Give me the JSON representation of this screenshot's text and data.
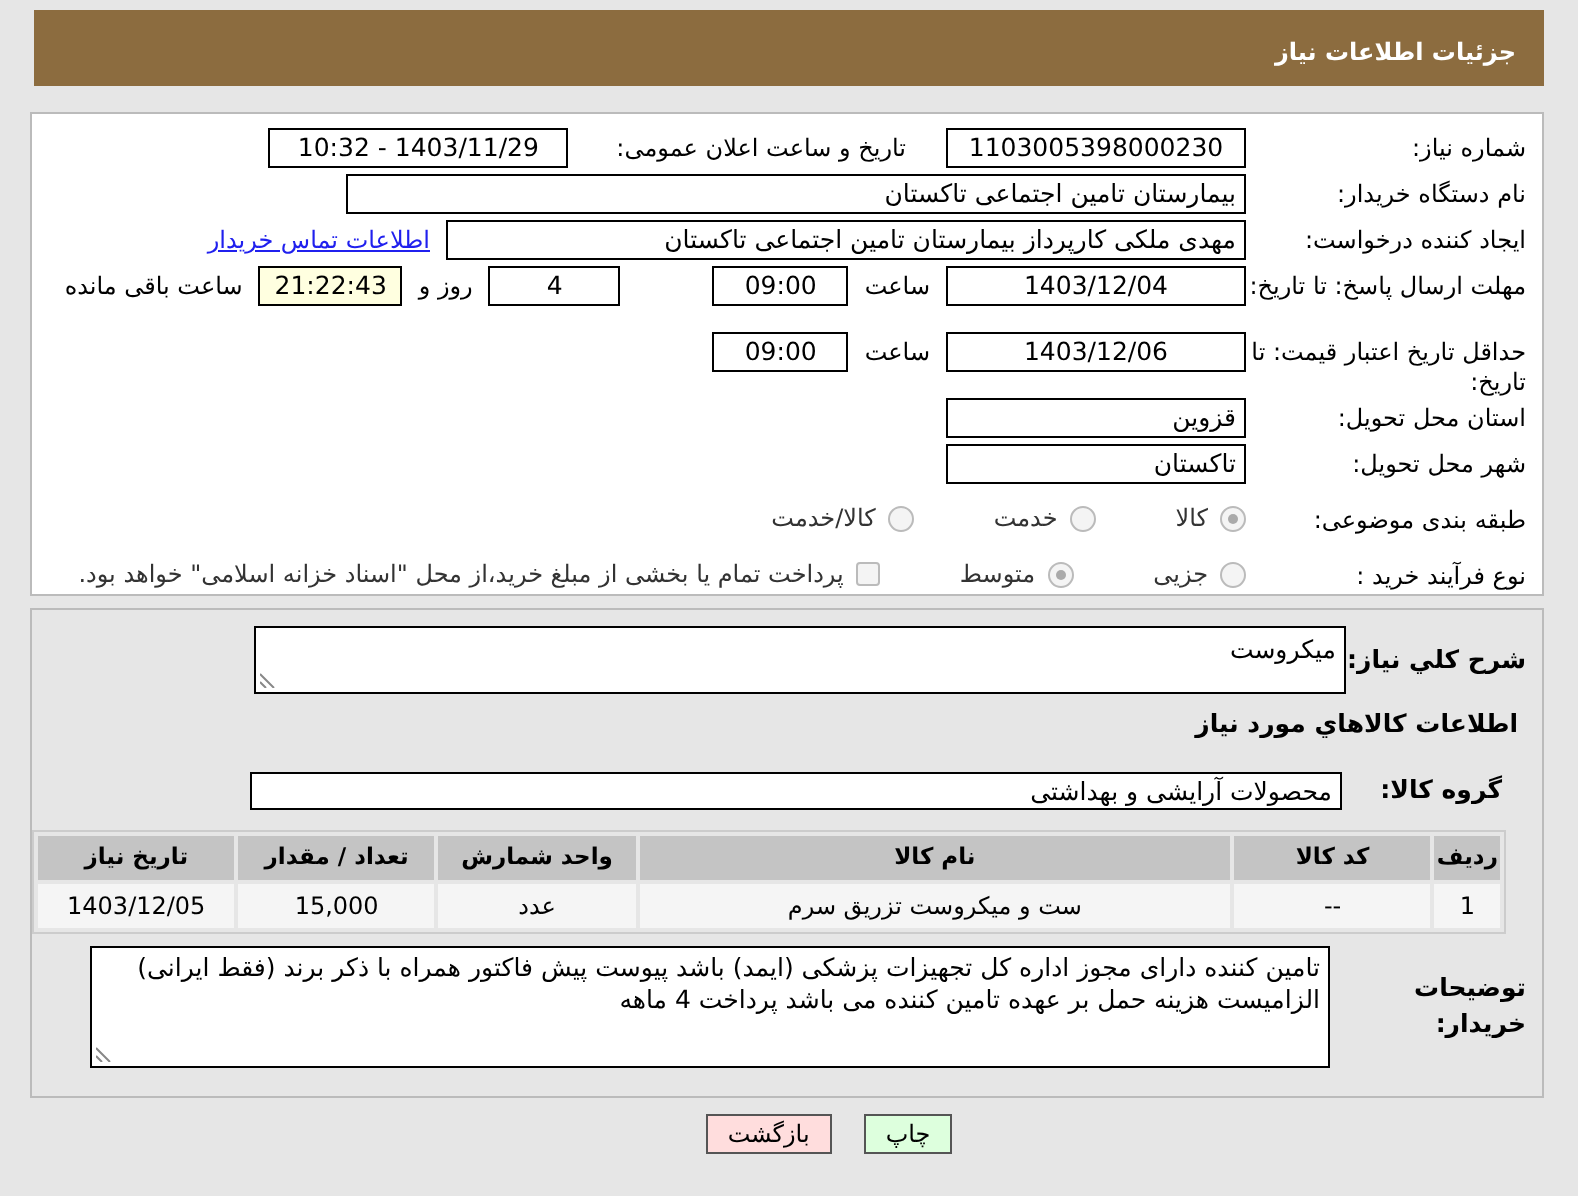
{
  "header": {
    "title": "جزئیات اطلاعات نیاز"
  },
  "form_rows": [
    {
      "label": "شماره نیاز:",
      "items": [
        {
          "kind": "field",
          "value": "1103005398000230"
        },
        {
          "kind": "text",
          "value": "تاریخ و ساعت اعلان عمومی:"
        },
        {
          "kind": "field",
          "value": "1403/11/29 - 10:32"
        }
      ]
    },
    {
      "label": "نام دستگاه خریدار:",
      "items": [
        {
          "kind": "field",
          "value": "بیمارستان تامین اجتماعی تاکستان"
        }
      ]
    },
    {
      "label": "ایجاد کننده درخواست:",
      "items": [
        {
          "kind": "field",
          "value": "مهدی ملکی کارپرداز بیمارستان تامین اجتماعی تاکستان"
        },
        {
          "kind": "link",
          "value": "اطلاعات تماس خریدار"
        }
      ]
    },
    {
      "label": "مهلت ارسال پاسخ: تا تاریخ:",
      "items": [
        {
          "kind": "field",
          "value": "1403/12/04"
        },
        {
          "kind": "text",
          "value": "ساعت"
        },
        {
          "kind": "field",
          "value": "09:00"
        },
        {
          "kind": "field",
          "value": "4"
        },
        {
          "kind": "text",
          "value": "روز و"
        },
        {
          "kind": "countdown",
          "value": "21:22:43"
        },
        {
          "kind": "text",
          "value": "ساعت باقی مانده"
        }
      ]
    },
    {
      "label": "حداقل تاریخ اعتبار قیمت: تا تاریخ:",
      "items": [
        {
          "kind": "field",
          "value": "1403/12/06"
        },
        {
          "kind": "text",
          "value": "ساعت"
        },
        {
          "kind": "field",
          "value": "09:00"
        }
      ]
    },
    {
      "label": "استان محل تحویل:",
      "items": [
        {
          "kind": "field",
          "value": "قزوین"
        }
      ]
    },
    {
      "label": "شهر محل تحویل:",
      "items": [
        {
          "kind": "field",
          "value": "تاکستان"
        }
      ]
    },
    {
      "label": "طبقه بندی موضوعی:",
      "items": [
        {
          "kind": "radio",
          "value": "کالا",
          "selected": true,
          "disabled": true
        },
        {
          "kind": "radio",
          "value": "خدمت",
          "selected": false,
          "disabled": true
        },
        {
          "kind": "radio",
          "value": "کالا/خدمت",
          "selected": false,
          "disabled": true
        }
      ]
    },
    {
      "label": "نوع فرآیند خرید :",
      "items": [
        {
          "kind": "radio",
          "value": "جزیی",
          "selected": false,
          "disabled": true
        },
        {
          "kind": "radio",
          "value": "متوسط",
          "selected": true,
          "disabled": true
        },
        {
          "kind": "checkbox",
          "value": "پرداخت تمام یا بخشی از مبلغ خرید،از محل \"اسناد خزانه اسلامی\" خواهد بود.",
          "checked": false,
          "disabled": true
        }
      ]
    }
  ],
  "description": {
    "label": "شرح کلي نياز:",
    "value": "میکروست"
  },
  "section_title": "اطلاعات كالاهاي مورد نياز",
  "goods_group": {
    "label": "گروه کالا:",
    "value": "محصولات آرایشی و بهداشتی"
  },
  "table": {
    "columns": [
      "ردیف",
      "کد کالا",
      "نام کالا",
      "واحد شمارش",
      "تعداد / مقدار",
      "تاریخ نیاز"
    ],
    "rows": [
      [
        "1",
        "--",
        "ست و میکروست تزریق سرم",
        "عدد",
        "15,000",
        "1403/12/05"
      ]
    ]
  },
  "buyer_notes": {
    "label": "توضیحات خریدار:",
    "value": "تامین کننده دارای مجوز اداره کل تجهیزات پزشکی (ایمد) باشد پیوست پیش فاکتور همراه با ذکر برند (فقط ایرانی) الزامیست هزینه حمل بر عهده تامین کننده می باشد  پرداخت 4 ماهه"
  },
  "buttons": [
    {
      "kind": "print",
      "label": "چاپ"
    },
    {
      "kind": "back",
      "label": "بازگشت"
    }
  ]
}
